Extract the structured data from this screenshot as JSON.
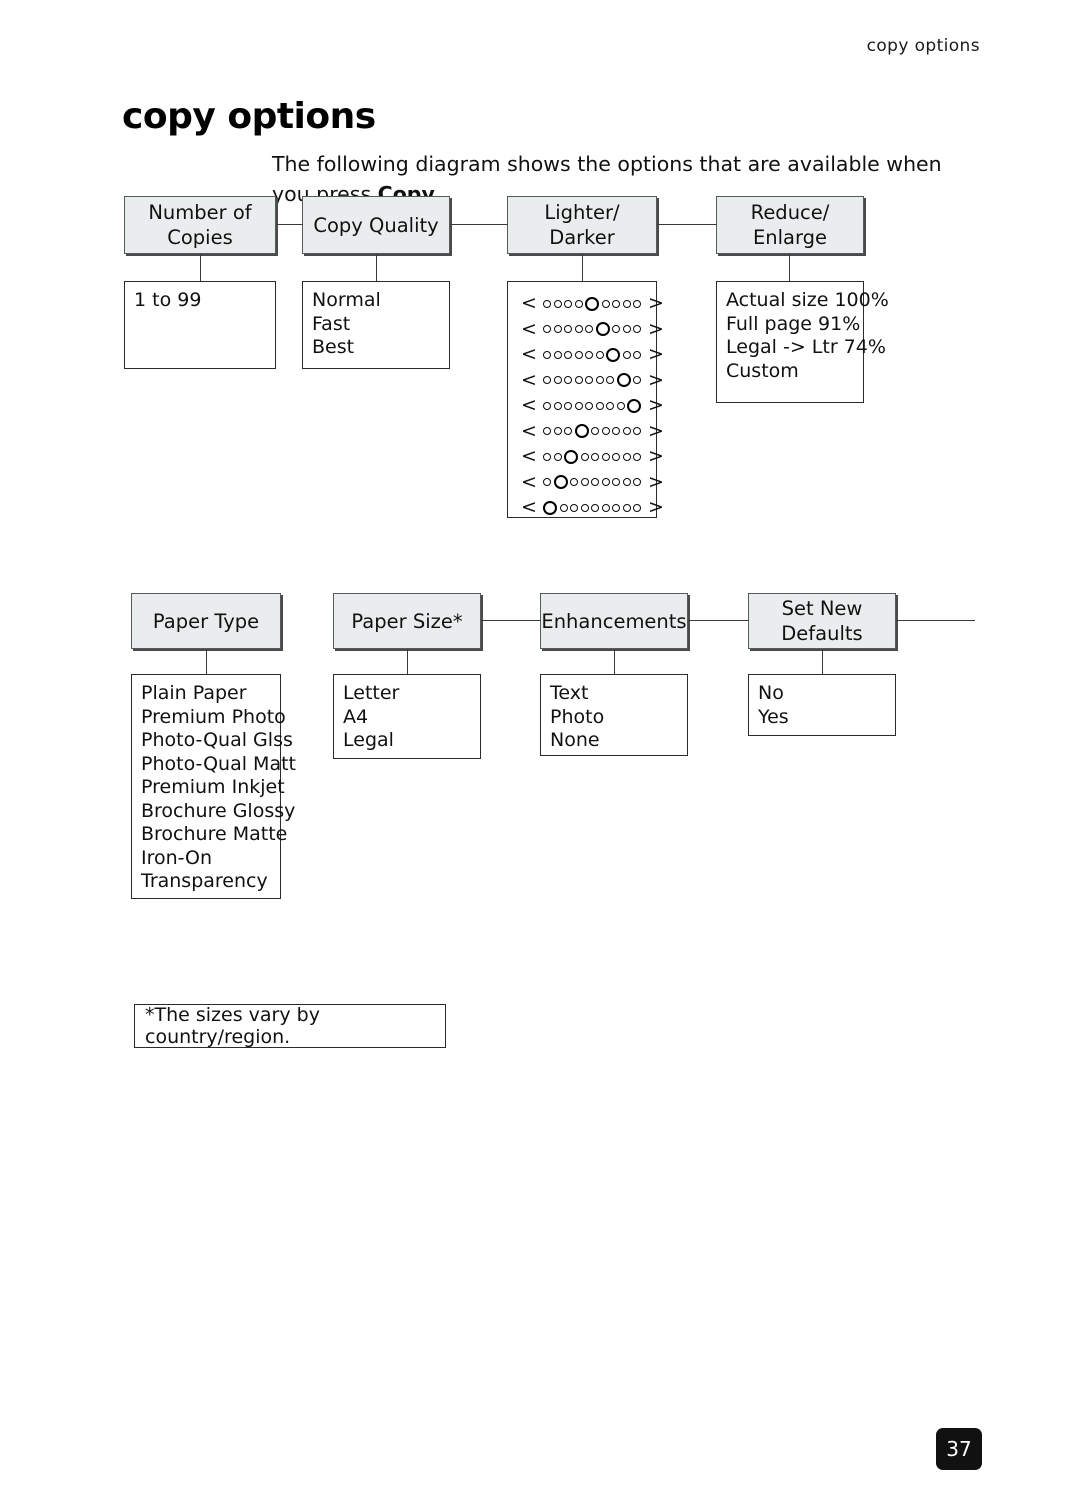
{
  "running_header": "copy options",
  "page_title": "copy options",
  "intro": {
    "text_before": "The following diagram shows the options that are available when you press ",
    "bold_word": "Copy",
    "text_after": "."
  },
  "diagram": {
    "row1": [
      {
        "id": "number-of-copies",
        "header": "Number of\nCopies",
        "header_line1": "Number of",
        "header_line2": "Copies",
        "options": [
          "1 to 99"
        ]
      },
      {
        "id": "copy-quality",
        "header_line1": "Copy Quality",
        "header_line2": "",
        "options": [
          "Normal",
          "Fast",
          "Best"
        ]
      },
      {
        "id": "lighter-darker",
        "header_line1": "Lighter/",
        "header_line2": "Darker",
        "options": []
      },
      {
        "id": "reduce-enlarge",
        "header_line1": "Reduce/",
        "header_line2": "Enlarge",
        "options": [
          "Actual size 100%",
          "Full page 91%",
          "Legal -> Ltr 74%",
          "Custom"
        ]
      }
    ],
    "row2": [
      {
        "id": "paper-type",
        "header_line1": "Paper Type",
        "header_line2": "",
        "options": [
          "Plain Paper",
          "Premium Photo",
          "Photo-Qual Glss",
          "Photo-Qual Matt",
          "Premium Inkjet",
          "Brochure Glossy",
          "Brochure Matte",
          "Iron-On",
          "Transparency"
        ]
      },
      {
        "id": "paper-size",
        "header_line1": "Paper Size*",
        "header_line2": "",
        "options": [
          "Letter",
          "A4",
          "Legal"
        ]
      },
      {
        "id": "enhancements",
        "header_line1": "Enhancements",
        "header_line2": "",
        "options": [
          "Text",
          "Photo",
          "None"
        ]
      },
      {
        "id": "set-new-defaults",
        "header_line1": "Set New",
        "header_line2": "Defaults",
        "options": [
          "No",
          "Yes"
        ]
      }
    ],
    "lighter_darker_slider": {
      "total_positions": 9,
      "arrow_left": "<",
      "arrow_right": ">",
      "rows": [
        {
          "marker_index": 4
        },
        {
          "marker_index": 5
        },
        {
          "marker_index": 6
        },
        {
          "marker_index": 7
        },
        {
          "marker_index": 8
        },
        {
          "marker_index": 3
        },
        {
          "marker_index": 2
        },
        {
          "marker_index": 1
        },
        {
          "marker_index": 0
        }
      ]
    }
  },
  "footnote": "*The sizes vary by country/region.",
  "page_number": "37",
  "colors": {
    "header_box_fill": "#e9eded",
    "header_box_border": "#58595b",
    "detail_box_border": "#2b2b2b",
    "connector": "#3a3a3a",
    "page_badge": "#111111"
  }
}
